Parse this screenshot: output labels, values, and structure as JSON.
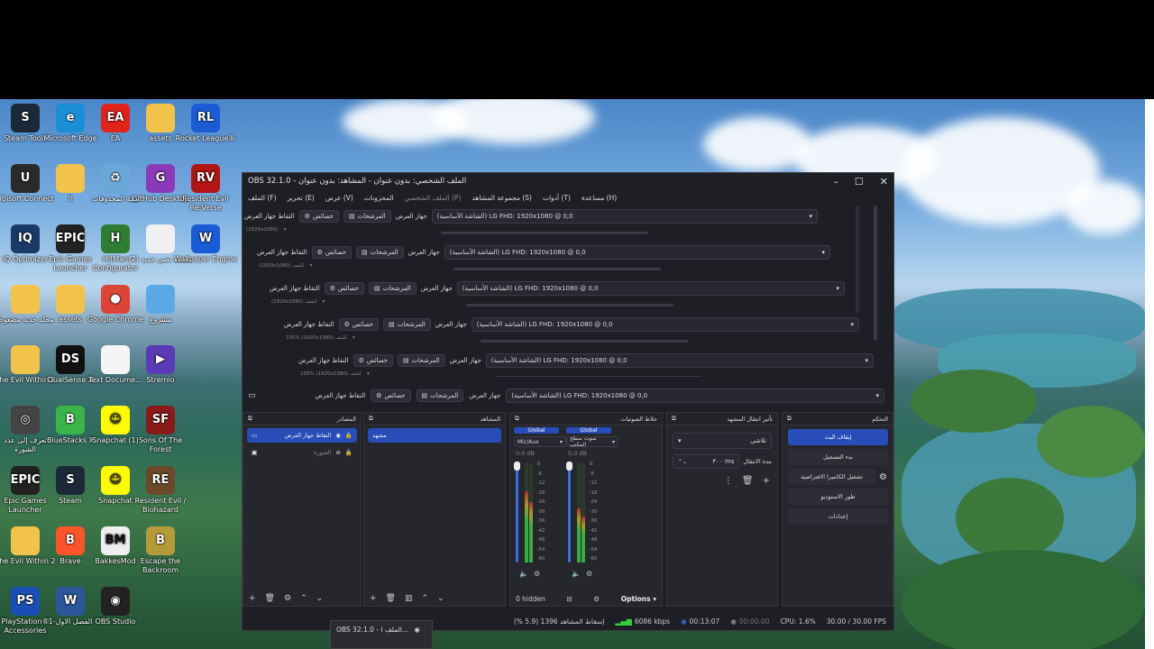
{
  "colors": {
    "accent": "#284cb8",
    "obs_bg": "#1e1f24",
    "dock_bg": "#26272d"
  },
  "desktop_icons": [
    {
      "label": "Steam Tools",
      "icon": "steam-tools-icon",
      "color": "#1b2838",
      "glyph": "S"
    },
    {
      "label": "Microsoft Edge",
      "icon": "edge-icon",
      "color": "#1a8fd6",
      "glyph": "e"
    },
    {
      "label": "EA",
      "icon": "ea-icon",
      "color": "#e2231a",
      "glyph": "EA"
    },
    {
      "label": "assets",
      "icon": "folder-icon",
      "color": "#f2c34a",
      "glyph": ""
    },
    {
      "label": "Rocket League®",
      "icon": "rocket-league-icon",
      "color": "#1c5bd6",
      "glyph": "RL"
    },
    {
      "label": "Ubisoft Connect",
      "icon": "ubisoft-icon",
      "color": "#2a2a2a",
      "glyph": "U"
    },
    {
      "label": "ll",
      "icon": "folder-icon",
      "color": "#f2c34a",
      "glyph": ""
    },
    {
      "label": "سلة المحذوفات",
      "icon": "recycle-bin-icon",
      "color": "#6aa7d8",
      "glyph": "♻"
    },
    {
      "label": "GitHub Desktop",
      "icon": "github-icon",
      "color": "#8a3ab9",
      "glyph": "G"
    },
    {
      "label": "Resident Evil Re:Verse",
      "icon": "re-verse-icon",
      "color": "#b31414",
      "glyph": "RV"
    },
    {
      "label": "IQ Optimizer",
      "icon": "iq-optimizer-icon",
      "color": "#1a3a6a",
      "glyph": "IQ"
    },
    {
      "label": "Epic Games Launcher",
      "icon": "epic-games-icon",
      "color": "#222",
      "glyph": "EPIC"
    },
    {
      "label": "HitMan Configurator",
      "icon": "hitman-icon",
      "color": "#2e7d32",
      "glyph": "H"
    },
    {
      "label": "مستند نصي جديد (2)",
      "icon": "text-document-icon",
      "color": "#f0f0f0",
      "glyph": ""
    },
    {
      "label": "Wallpaper Engine",
      "icon": "wallpaper-engine-icon",
      "color": "#1a5bd6",
      "glyph": "W"
    },
    {
      "label": "مجلد جديد مضغوط",
      "icon": "zip-folder-icon",
      "color": "#f2c34a",
      "glyph": ""
    },
    {
      "label": "assets",
      "icon": "folder-icon",
      "color": "#f2c34a",
      "glyph": ""
    },
    {
      "label": "Google Chrome",
      "icon": "chrome-icon",
      "color": "#db4437",
      "glyph": "●"
    },
    {
      "label": "مشروع",
      "icon": "folder-icon",
      "color": "#5aa9e6",
      "glyph": ""
    },
    {
      "label": "The Evil Within 2",
      "icon": "evil-within-icon",
      "color": "#f2c34a",
      "glyph": ""
    },
    {
      "label": "DualSense X",
      "icon": "dualsense-icon",
      "color": "#111",
      "glyph": "DS"
    },
    {
      "label": "Text Docume...",
      "icon": "text-document-icon",
      "color": "#f5f5f5",
      "glyph": ""
    },
    {
      "label": "Stremio",
      "icon": "stremio-icon",
      "color": "#5b3ab5",
      "glyph": "▶"
    },
    {
      "label": "تعرف إلى عدد الشورة",
      "icon": "app-icon",
      "color": "#444",
      "glyph": "◎"
    },
    {
      "label": "BlueStacks X",
      "icon": "bluestacks-icon",
      "color": "#3bb54a",
      "glyph": "B"
    },
    {
      "label": "Snapchat (1)",
      "icon": "snapchat-icon",
      "color": "#fffc00",
      "glyph": "☺"
    },
    {
      "label": "Sons Of The Forest",
      "icon": "sons-forest-icon",
      "color": "#8a1a1a",
      "glyph": "SF"
    },
    {
      "label": "Epic Games Launcher",
      "icon": "epic-games-icon",
      "color": "#222",
      "glyph": "EPIC"
    },
    {
      "label": "Steam",
      "icon": "steam-icon",
      "color": "#1b2838",
      "glyph": "S"
    },
    {
      "label": "Snapchat",
      "icon": "snapchat-icon",
      "color": "#fffc00",
      "glyph": "☺"
    },
    {
      "label": "Resident Evil / Biohazard",
      "icon": "resident-evil-icon",
      "color": "#6a4a2a",
      "glyph": "RE"
    },
    {
      "label": "The Evil Within 2",
      "icon": "folder-icon",
      "color": "#f2c34a",
      "glyph": ""
    },
    {
      "label": "Brave",
      "icon": "brave-icon",
      "color": "#fb542b",
      "glyph": "B"
    },
    {
      "label": "BakkesMod",
      "icon": "bakkesmod-icon",
      "color": "#eee",
      "glyph": "BM"
    },
    {
      "label": "Escape the Backroom",
      "icon": "escape-backroom-icon",
      "color": "#b59a3a",
      "glyph": "B"
    },
    {
      "label": "PlayStation® Accessories",
      "icon": "playstation-icon",
      "color": "#1a4fb5",
      "glyph": "PS"
    },
    {
      "label": "الفصل الاول-1",
      "icon": "word-doc-icon",
      "color": "#2b579a",
      "glyph": "W"
    },
    {
      "label": "OBS Studio",
      "icon": "obs-icon",
      "color": "#222",
      "glyph": "◉"
    }
  ],
  "obs": {
    "title": "الملف الشخصي: بدون عنوان - المشاهد: بدون عنوان - OBS 32.1.0",
    "menu": [
      {
        "label": "الملف (F)",
        "dim": false
      },
      {
        "label": "تحرير (E)",
        "dim": false
      },
      {
        "label": "عرض (V)",
        "dim": false
      },
      {
        "label": "المحزونات",
        "dim": false
      },
      {
        "label": "الملف الشخصي (P)",
        "dim": true
      },
      {
        "label": "مجموعة المشاهد (S)",
        "dim": false
      },
      {
        "label": "أدوات (T)",
        "dim": false
      },
      {
        "label": "مساعدة (H)",
        "dim": false
      }
    ],
    "preview_rows": [
      {
        "source": "التقاط جهاز العرض",
        "props": "خصائص",
        "filters": "المرشحات",
        "device_label": "جهاز العرض",
        "device": "(الشاشة الأساسية) LG FHD: 1920x1080 @ 0,0",
        "sub": "(1920x1080)"
      },
      {
        "source": "التقاط جهاز العرض",
        "props": "خصائص",
        "filters": "المرشحات",
        "device_label": "جهاز العرض",
        "device": "(الشاشة الأساسية) LG FHD: 1920x1080 @ 0,0",
        "sub": "(1920x1080) كشف"
      },
      {
        "source": "التقاط جهاز العرض",
        "props": "خصائص",
        "filters": "المرشحات",
        "device_label": "جهاز العرض",
        "device": "(الشاشة الأساسية) LG FHD: 1920x1080 @ 0,0",
        "sub": "(1920x1080) كشف"
      },
      {
        "source": "التقاط جهاز العرض",
        "props": "خصائص",
        "filters": "المرشحات",
        "device_label": "جهاز العرض",
        "device": "(الشاشة الأساسية) LG FHD: 1920x1080 @ 0,0",
        "sub": "100% (1920x1080) كشف"
      },
      {
        "source": "التقاط جهاز العرض",
        "props": "خصائص",
        "filters": "المرشحات",
        "device_label": "جهاز العرض",
        "device": "(الشاشة الأساسية) LG FHD: 1920x1080 @ 0,0",
        "sub": "100% (1920x1080) كشف"
      }
    ],
    "main_row": {
      "source": "التقاط جهاز العرض",
      "props": "خصائص",
      "filters": "المرشحات",
      "device_label": "جهاز العرض",
      "device": "(الشاشة الأساسية) LG FHD: 1920x1080 @ 0,0"
    },
    "sources": {
      "title": "المصادر",
      "items": [
        {
          "label": "التقاط جهاز العرض",
          "selected": true
        },
        {
          "label": "الصورة",
          "selected": false
        }
      ]
    },
    "scenes": {
      "title": "المشاهد",
      "items": [
        "مشهد"
      ]
    },
    "mixer": {
      "title": "خلاط الصوتيات",
      "channels": [
        {
          "global": "Global",
          "name": "Mic/Aux",
          "db": "0.0 dB",
          "level": 0.72
        },
        {
          "global": "Global",
          "name": "صوت سطح المكتب",
          "db": "0.0 dB",
          "level": 0.55
        }
      ],
      "scale": [
        "0",
        "-6",
        "-12",
        "-18",
        "-24",
        "-30",
        "-36",
        "-42",
        "-48",
        "-54",
        "-60"
      ],
      "hidden": "0 hidden",
      "options": "Options"
    },
    "transitions": {
      "title": "تأثير انتقال المشهد",
      "type": "تلاشي",
      "duration_label": "مدة الانتقال",
      "duration": "٣٠٠ ms"
    },
    "controls": {
      "title": "التحكم",
      "buttons": [
        {
          "label": "إيقاف البث",
          "primary": true
        },
        {
          "label": "بدء التسجيل",
          "primary": false
        },
        {
          "label": "تشغيل الكاميرا الافتراضية",
          "primary": false
        },
        {
          "label": "طور الاستوديو",
          "primary": false
        },
        {
          "label": "إعدادات",
          "primary": false
        }
      ]
    },
    "status": {
      "dropped": "إسقاط المشاهد 1396 (5.9 %)",
      "bitrate": "6086 kbps",
      "stream_time": "00:13:07",
      "rec_time": "00:00:00",
      "cpu": "CPU: 1.6%",
      "fps": "30.00 / 30.00 FPS"
    }
  },
  "taskbar_preview": {
    "title": "OBS 32.1.0 - الملف ا..."
  }
}
